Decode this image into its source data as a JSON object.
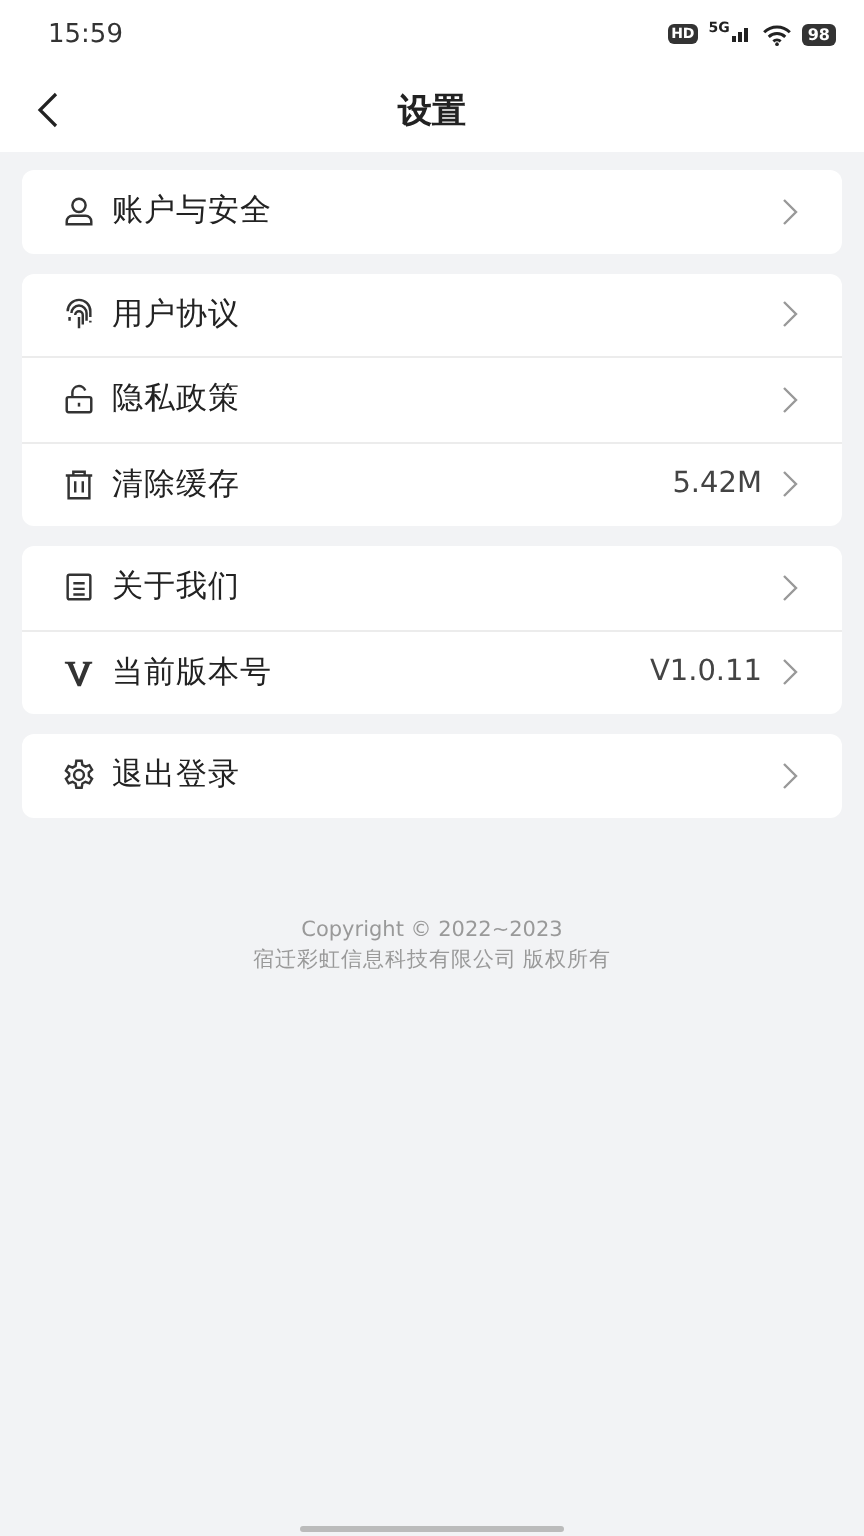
{
  "status_bar": {
    "time": "15:59",
    "hd": "HD",
    "network": "5G",
    "battery": "98"
  },
  "nav": {
    "title": "设置"
  },
  "groups": [
    {
      "items": [
        {
          "kind": "user",
          "label": "账户与安全"
        }
      ]
    },
    {
      "items": [
        {
          "kind": "fingerprint",
          "label": "用户协议"
        },
        {
          "kind": "lock",
          "label": "隐私政策"
        },
        {
          "kind": "trash",
          "label": "清除缓存",
          "value": "5.42M"
        }
      ]
    },
    {
      "items": [
        {
          "kind": "document",
          "label": "关于我们"
        },
        {
          "kind": "version",
          "label": "当前版本号",
          "value": "V1.0.11"
        }
      ]
    },
    {
      "items": [
        {
          "kind": "gear",
          "label": "退出登录"
        }
      ]
    }
  ],
  "footer": {
    "copyright": "Copyright ©  2022~2023",
    "company": "宿迁彩虹信息科技有限公司 版权所有"
  }
}
